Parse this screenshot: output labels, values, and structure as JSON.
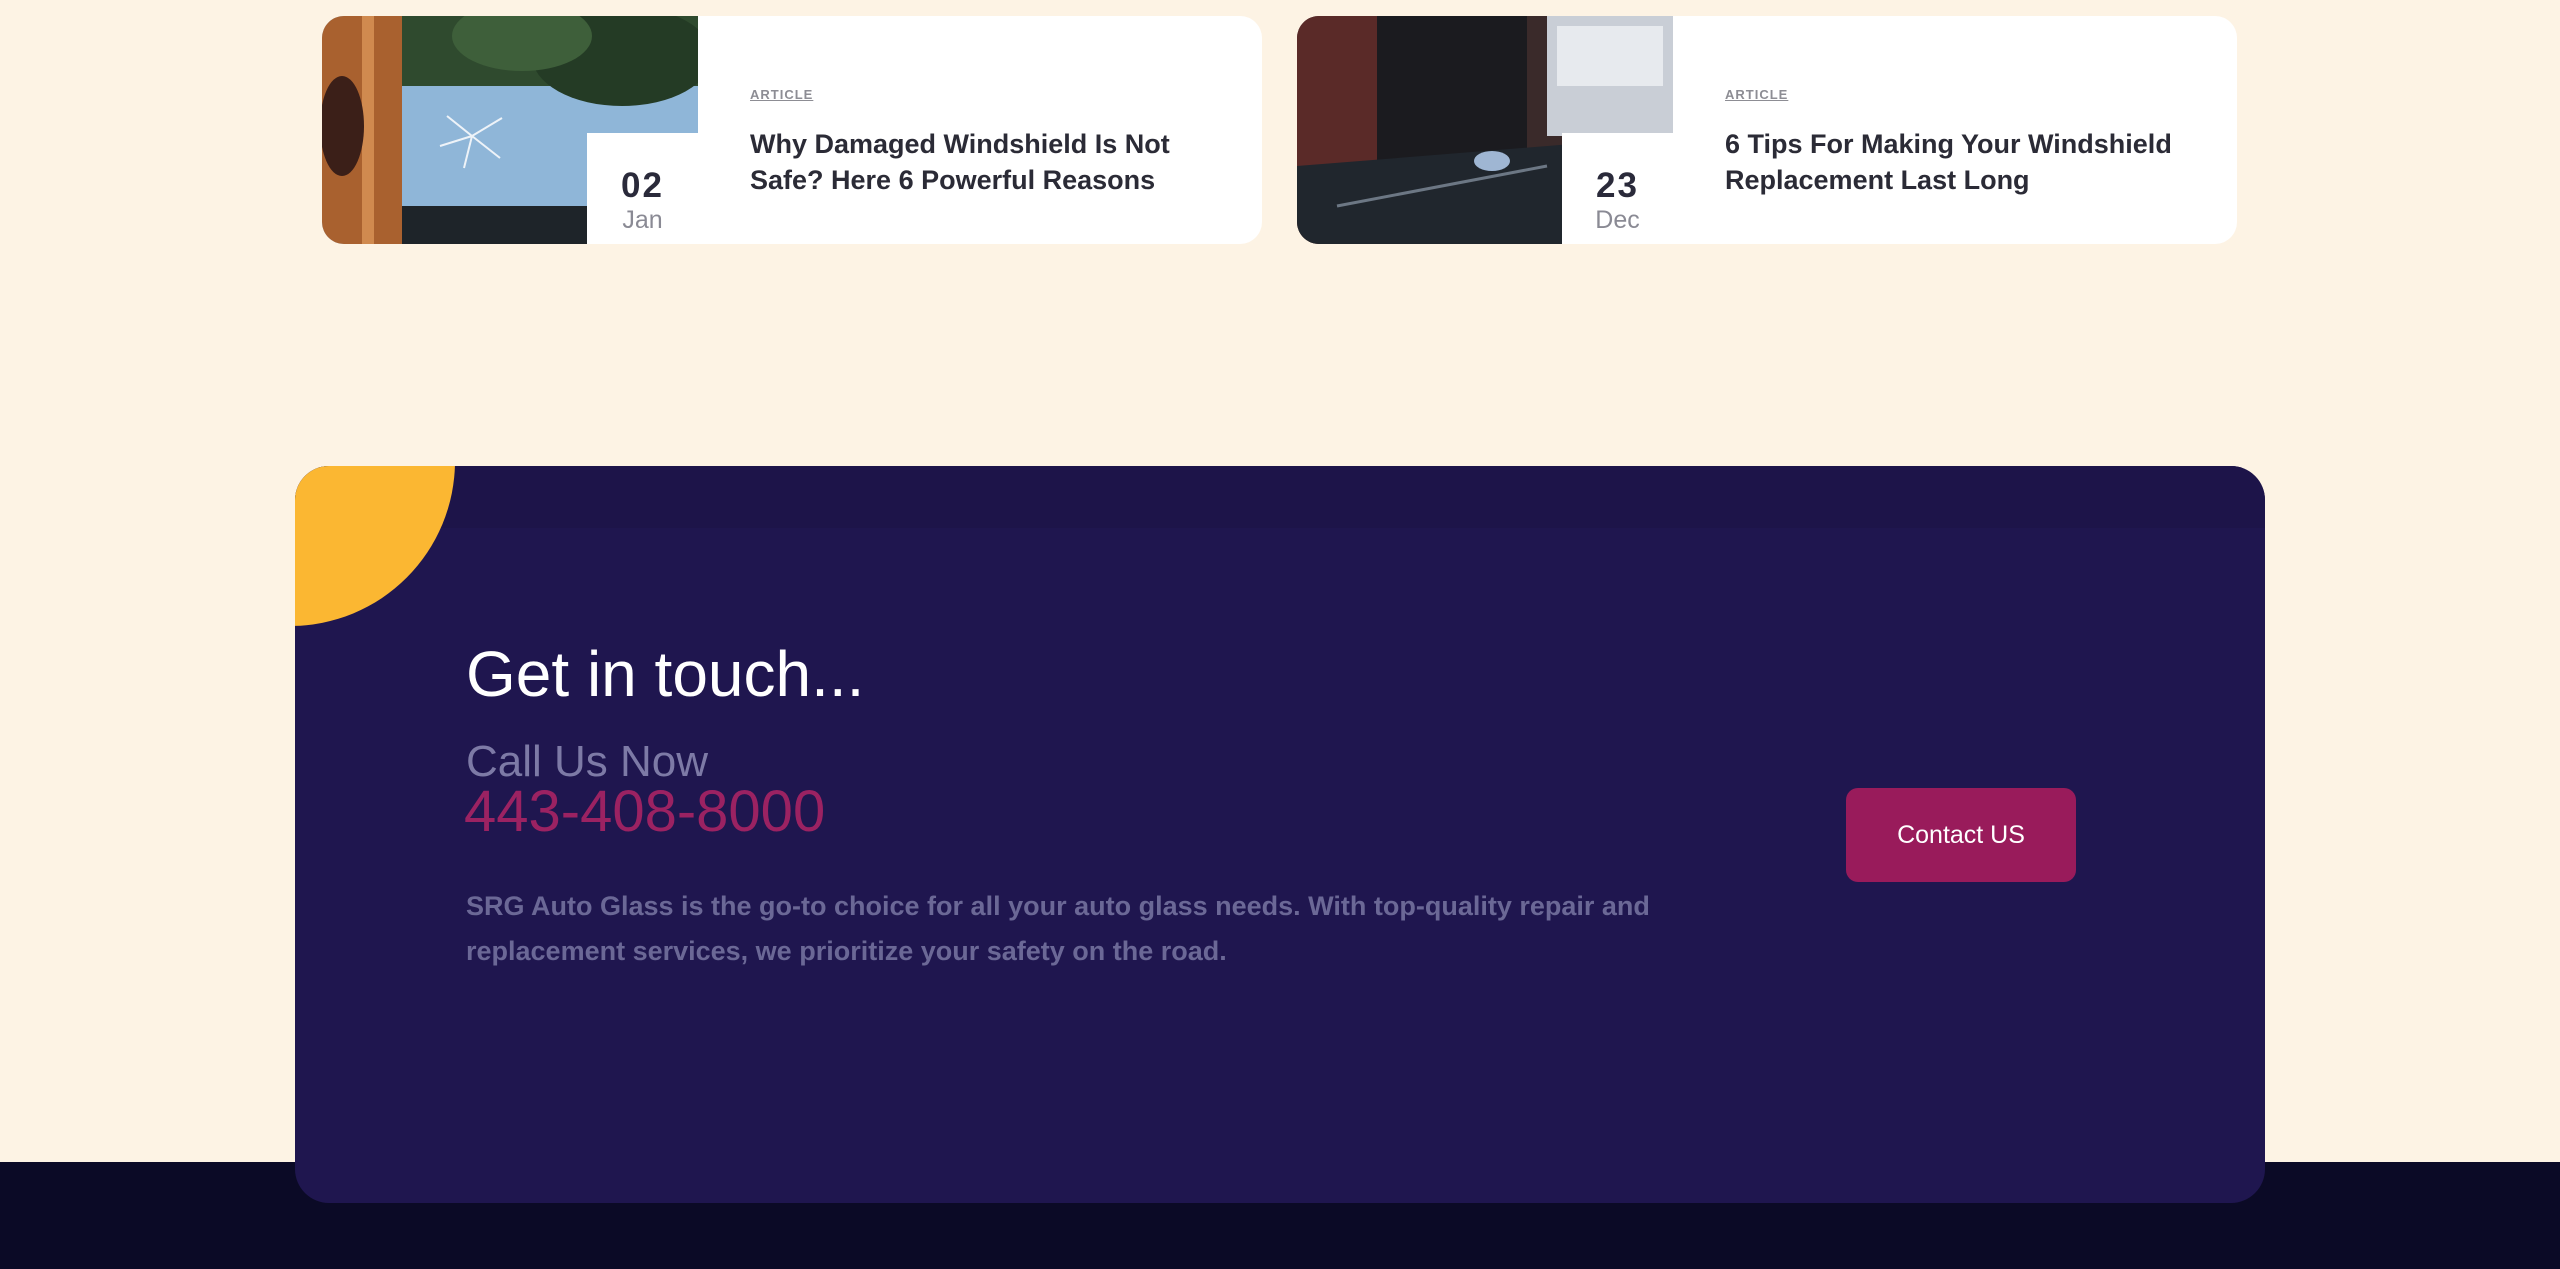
{
  "articles": [
    {
      "tag": "ARTICLE",
      "day": "02",
      "month": "Jan",
      "title": "Why Damaged Windshield Is Not Safe? Here 6 Powerful Reasons"
    },
    {
      "tag": "ARTICLE",
      "day": "23",
      "month": "Dec",
      "title": "6 Tips For Making Your Windshield Replacement Last Long"
    }
  ],
  "contact": {
    "title": "Get in touch...",
    "call_label": "Call Us Now",
    "phone": "443-408-8000",
    "description": "SRG Auto Glass is the go-to choice for all your auto glass needs. With top-quality repair and replacement services, we prioritize your safety on the road.",
    "button_label": "Contact US"
  },
  "colors": {
    "page_background": "#fdf3e4",
    "panel_background": "#1f164f",
    "accent_yellow": "#fbb732",
    "phone_color": "#9b2262",
    "button_background": "#991b5b",
    "footer_background": "#0b0a26"
  }
}
